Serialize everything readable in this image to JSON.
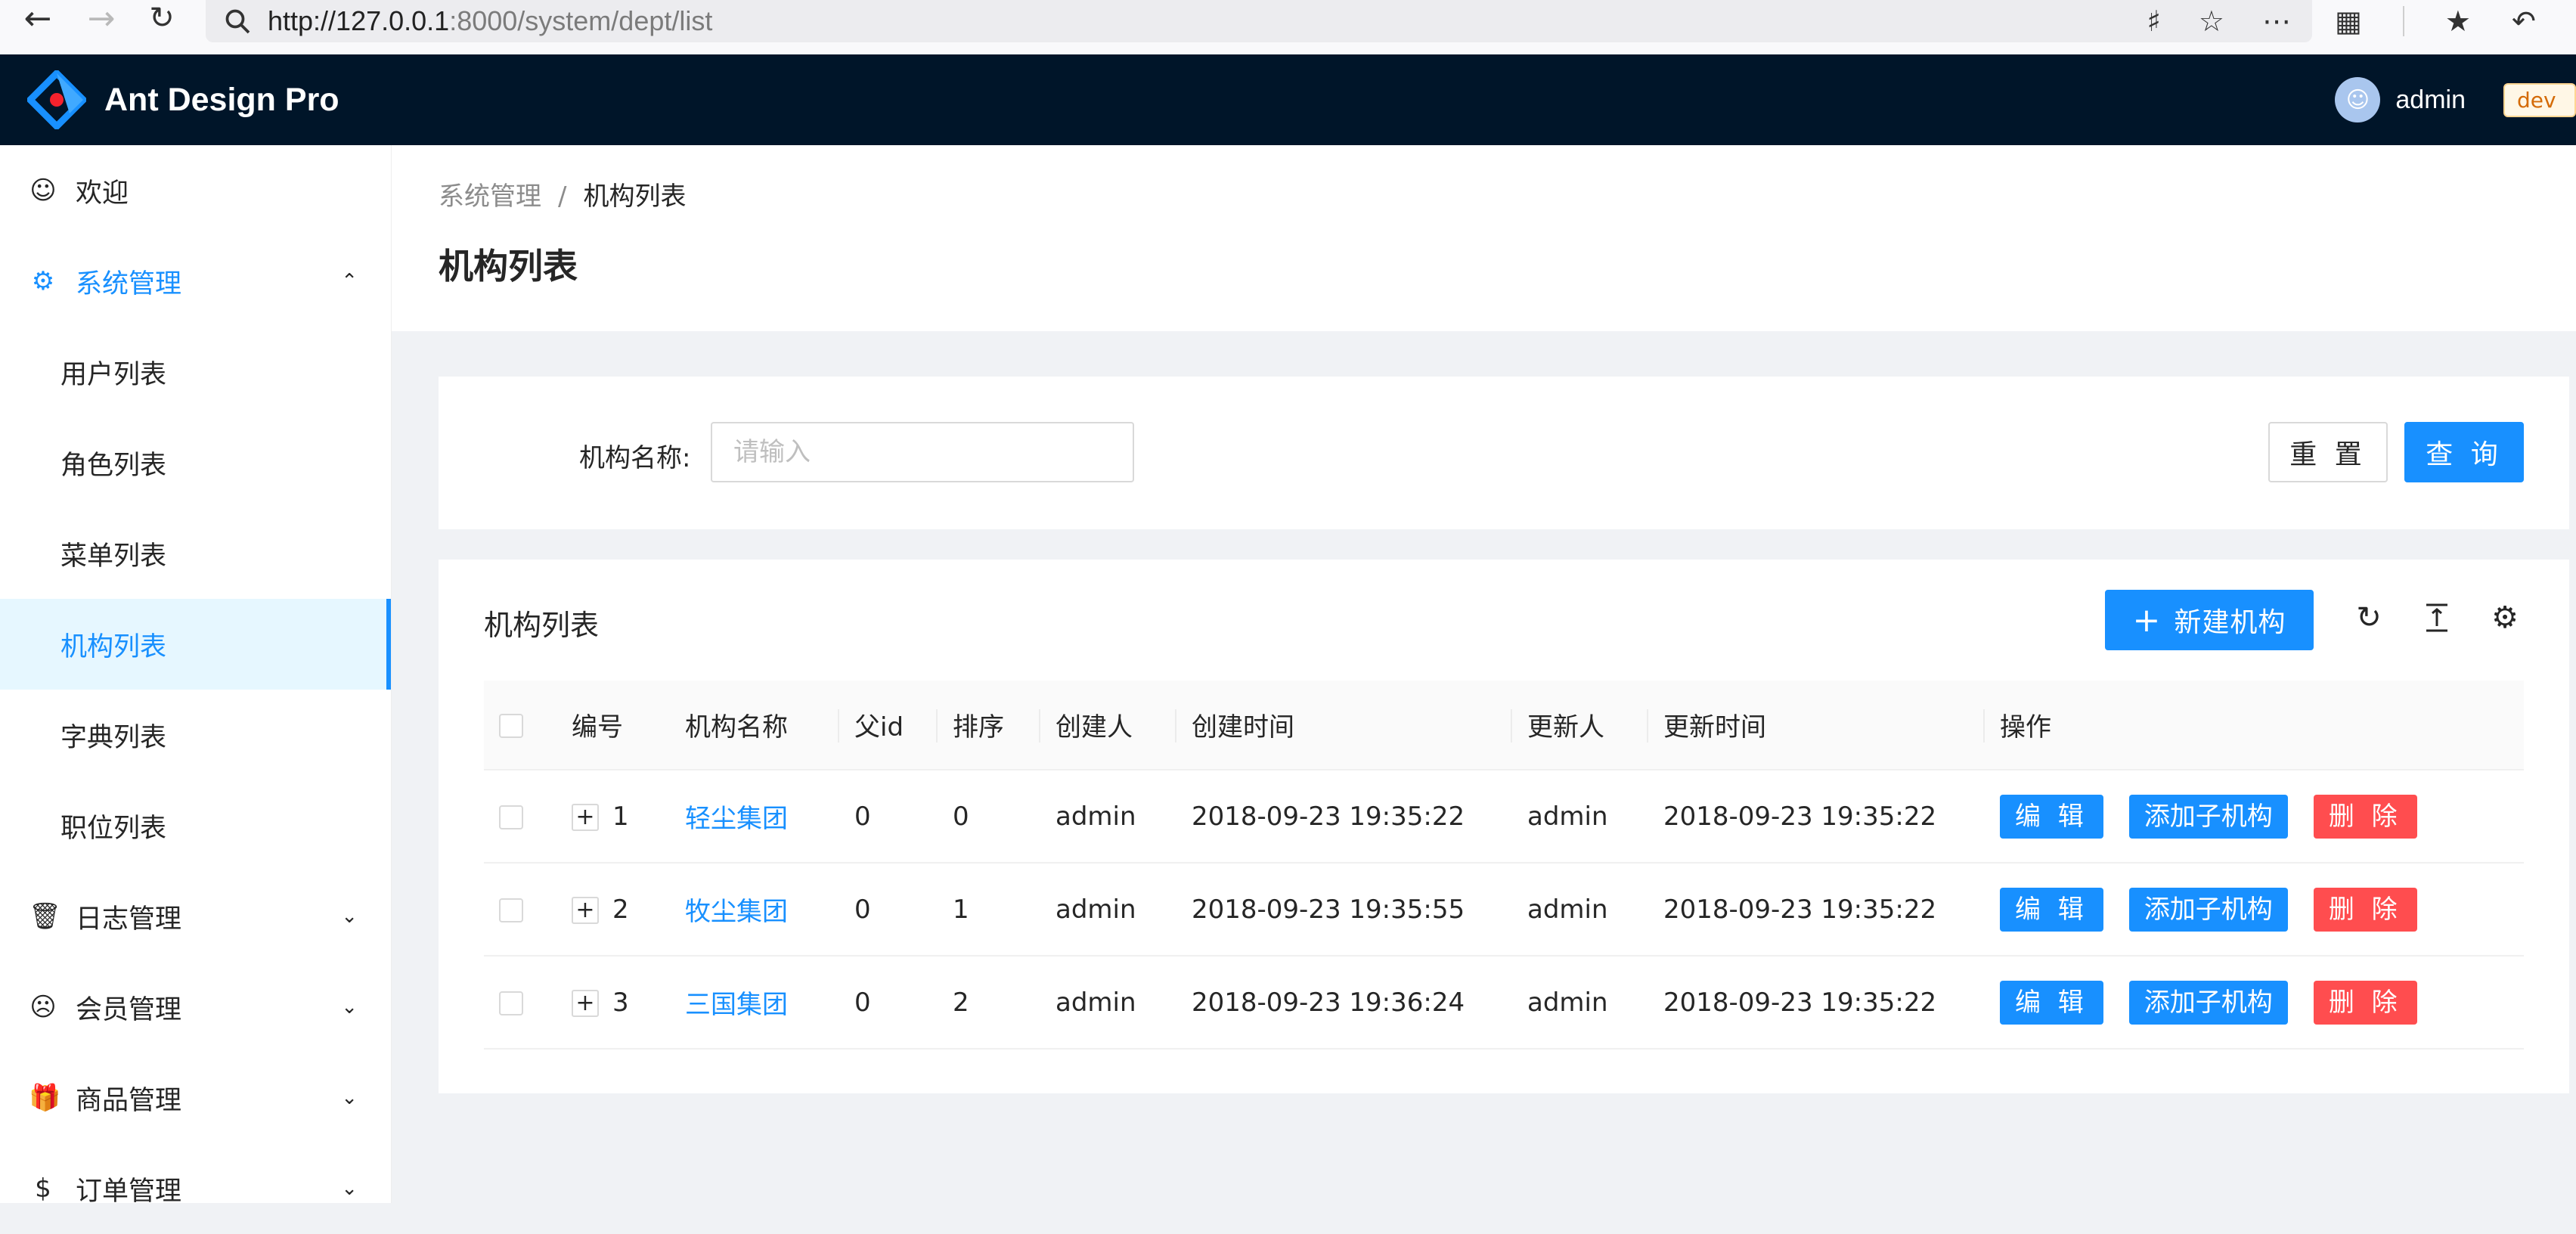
{
  "browser": {
    "url_host": "http://127.0.0.1",
    "url_path": ":8000/system/dept/list"
  },
  "header": {
    "app_title": "Ant Design Pro",
    "user_name": "admin",
    "env_tag": "dev"
  },
  "sidebar": {
    "items": [
      {
        "label": "欢迎",
        "icon": "smile-icon"
      },
      {
        "label": "系统管理",
        "icon": "gear-icon"
      },
      {
        "label": "用户列表"
      },
      {
        "label": "角色列表"
      },
      {
        "label": "菜单列表"
      },
      {
        "label": "机构列表"
      },
      {
        "label": "字典列表"
      },
      {
        "label": "职位列表"
      },
      {
        "label": "日志管理",
        "icon": "trash-icon"
      },
      {
        "label": "会员管理",
        "icon": "frown-icon"
      },
      {
        "label": "商品管理",
        "icon": "gift-icon"
      },
      {
        "label": "订单管理",
        "icon": "dollar-icon"
      }
    ]
  },
  "page": {
    "breadcrumb": [
      "系统管理",
      "/",
      "机构列表"
    ],
    "title": "机构列表"
  },
  "search": {
    "label": "机构名称:",
    "placeholder": "请输入",
    "reset_label": "重 置",
    "query_label": "查 询"
  },
  "table": {
    "title": "机构列表",
    "new_button": "新建机构",
    "columns": [
      "编号",
      "机构名称",
      "父id",
      "排序",
      "创建人",
      "创建时间",
      "更新人",
      "更新时间",
      "操作"
    ],
    "rows": [
      {
        "id": "1",
        "name": "轻尘集团",
        "parent_id": "0",
        "sort": "0",
        "creator": "admin",
        "created": "2018-09-23 19:35:22",
        "updater": "admin",
        "updated": "2018-09-23 19:35:22"
      },
      {
        "id": "2",
        "name": "牧尘集团",
        "parent_id": "0",
        "sort": "1",
        "creator": "admin",
        "created": "2018-09-23 19:35:55",
        "updater": "admin",
        "updated": "2018-09-23 19:35:22"
      },
      {
        "id": "3",
        "name": "三国集团",
        "parent_id": "0",
        "sort": "2",
        "creator": "admin",
        "created": "2018-09-23 19:36:24",
        "updater": "admin",
        "updated": "2018-09-23 19:35:22"
      }
    ],
    "actions": {
      "edit": "编 辑",
      "add_child": "添加子机构",
      "delete": "删 除"
    }
  },
  "colors": {
    "primary": "#1890ff",
    "danger": "#ff4d4f",
    "header_bg": "#001529"
  }
}
